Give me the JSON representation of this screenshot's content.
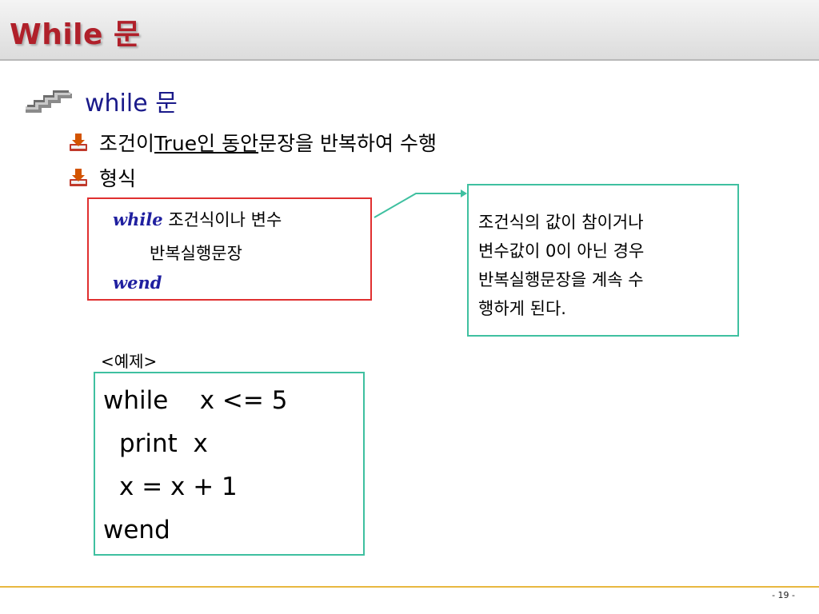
{
  "slide": {
    "title": "While  문",
    "bullet": "while  문",
    "sub_items": [
      {
        "before": "조건이 ",
        "underlined": "True인 동안",
        "after": " 문장을 반복하여 수행"
      },
      {
        "text": "형식"
      }
    ],
    "syntax": {
      "line1_keyword": "while",
      "line1_rest": " 조건식이나 변수",
      "line2": "반복실행문장",
      "line3_keyword": "wend"
    },
    "note": {
      "lines": [
        "조건식의 값이 참이거나",
        "변수값이 0이 아닌 경우",
        "반복실행문장을 계속 수",
        "행하게 된다."
      ]
    },
    "example_label": "<예제>",
    "code": [
      "while    x <= 5",
      "print  x",
      "x = x + 1",
      "wend"
    ],
    "page_number": "- 19 -"
  },
  "colors": {
    "title": "#b0202a",
    "keyword": "#2020a0",
    "syntax_border": "#e03030",
    "note_border": "#3fc0a0",
    "footer_line": "#e8b840"
  },
  "icons": {
    "main_bullet": "stair-arrow-icon",
    "sub_bullet": "download-arrow-icon"
  }
}
